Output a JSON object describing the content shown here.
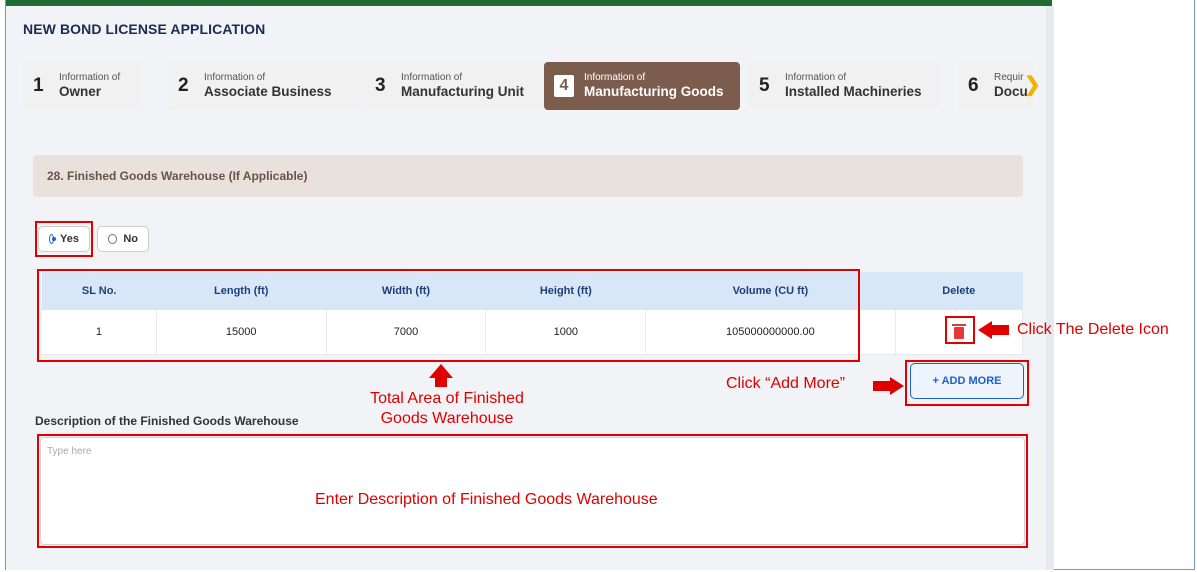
{
  "page": {
    "title": "NEW BOND LICENSE APPLICATION"
  },
  "steps": [
    {
      "num": "1",
      "small": "Information of",
      "large": "Owner"
    },
    {
      "num": "2",
      "small": "Information of",
      "large": "Associate Business"
    },
    {
      "num": "3",
      "small": "Information of",
      "large": "Manufacturing Unit"
    },
    {
      "num": "4",
      "small": "Information of",
      "large": "Manufacturing Goods",
      "active": true
    },
    {
      "num": "5",
      "small": "Information of",
      "large": "Installed Machineries"
    },
    {
      "num": "6",
      "small": "Requir",
      "large": "Docu"
    }
  ],
  "section": {
    "title": "28. Finished Goods Warehouse (If Applicable)"
  },
  "radio": {
    "yes": "Yes",
    "no": "No",
    "selected": "Yes"
  },
  "table": {
    "headers": [
      "SL No.",
      "Length (ft)",
      "Width (ft)",
      "Height (ft)",
      "Volume (CU ft)",
      "Delete"
    ],
    "rows": [
      [
        "1",
        "15000",
        "7000",
        "1000",
        "105000000000.00"
      ]
    ]
  },
  "buttons": {
    "add_more": "+ ADD MORE"
  },
  "description": {
    "label": "Description of the Finished Goods Warehouse",
    "placeholder": "Type here"
  },
  "annotations": {
    "delete": "Click The Delete Icon",
    "add_more": "Click “Add More”",
    "total_area_1": "Total Area of Finished",
    "total_area_2": "Goods Warehouse",
    "enter_desc": "Enter Description of Finished Goods Warehouse"
  },
  "colors": {
    "accent": "#7c5c4d",
    "primary": "#1d5fcc",
    "annotation": "#e00000",
    "table_header": "#d8e7f8"
  }
}
